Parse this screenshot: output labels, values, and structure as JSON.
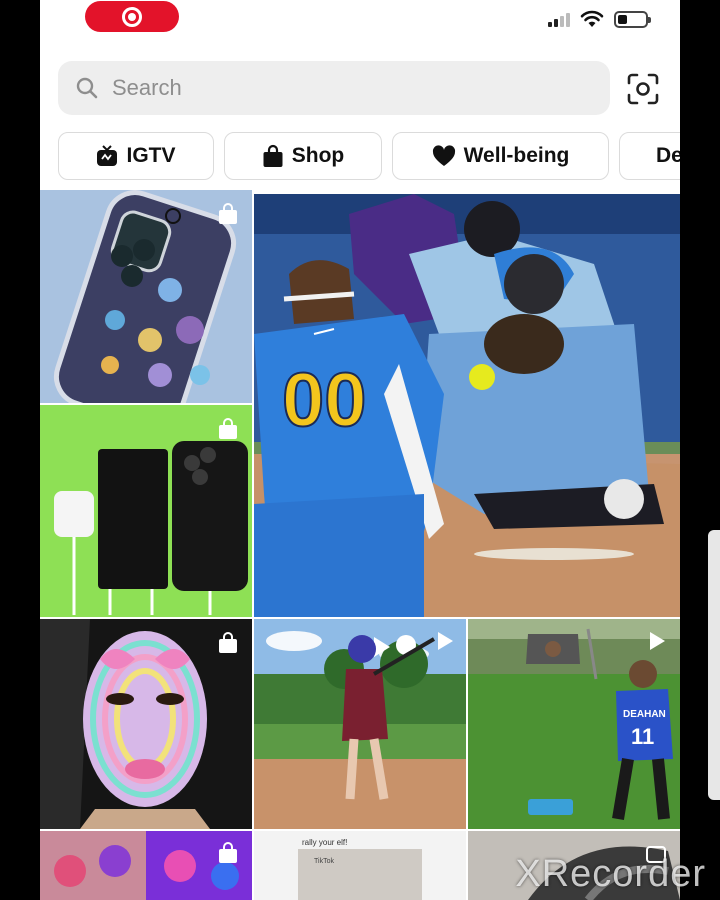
{
  "search": {
    "placeholder": "Search"
  },
  "chips": [
    {
      "label": "IGTV",
      "icon": "igtv-icon"
    },
    {
      "label": "Shop",
      "icon": "shopping-bag-icon"
    },
    {
      "label": "Well-being",
      "icon": "heart-icon"
    },
    {
      "label": "De"
    }
  ],
  "tiles": {
    "jersey_number": "00",
    "player_back_text": "DEAHAN",
    "player_back_number": "11",
    "post_caption_line": "rally your elf!",
    "post_app_label": "TikTok"
  },
  "watermark": {
    "text": "XRecorder"
  },
  "colors": {
    "record_pill": "#e3132a",
    "chip_border": "#dbdbdb",
    "search_bg": "#eeeeee"
  }
}
